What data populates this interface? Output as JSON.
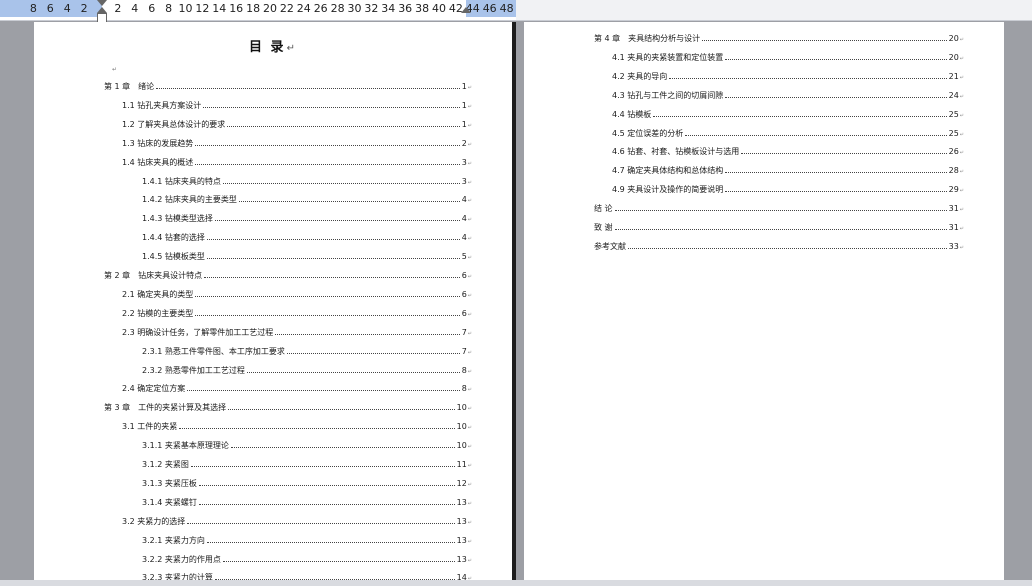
{
  "ruler": {
    "numbers": [
      "8",
      "6",
      "4",
      "2",
      "2",
      "4",
      "6",
      "8",
      "10",
      "12",
      "14",
      "16",
      "18",
      "20",
      "22",
      "24",
      "26",
      "28",
      "30",
      "32",
      "34",
      "36",
      "38",
      "40",
      "42",
      "44",
      "46",
      "48"
    ]
  },
  "toc_title": "目 录",
  "left_page": [
    {
      "level": 1,
      "label": "第 1 章　绪论",
      "page": "1"
    },
    {
      "level": 2,
      "label": "1.1  钻孔夹具方案设计",
      "page": "1"
    },
    {
      "level": 2,
      "label": "1.2  了解夹具总体设计的要求",
      "page": "1"
    },
    {
      "level": 2,
      "label": "1.3  钻床的发展趋势",
      "page": "2"
    },
    {
      "level": 2,
      "label": "1.4 钻床夹具的概述",
      "page": "3"
    },
    {
      "level": 3,
      "label": "1.4.1 钻床夹具的特点",
      "page": "3"
    },
    {
      "level": 3,
      "label": "1.4.2 钻床夹具的主要类型",
      "page": "4"
    },
    {
      "level": 3,
      "label": "1.4.3 钻模类型选择",
      "page": "4"
    },
    {
      "level": 3,
      "label": "1.4.4 钻套的选择",
      "page": "4"
    },
    {
      "level": 3,
      "label": "1.4.5 钻模板类型",
      "page": "5"
    },
    {
      "level": 1,
      "label": "第 2 章　钻床夹具设计特点",
      "page": "6"
    },
    {
      "level": 2,
      "label": "2.1  确定夹具的类型",
      "page": "6"
    },
    {
      "level": 2,
      "label": "2.2  钻模的主要类型",
      "page": "6"
    },
    {
      "level": 2,
      "label": "2.3  明确设计任务，了解零件加工工艺过程",
      "page": "7"
    },
    {
      "level": 3,
      "label": "2.3.1  熟悉工件零件图、本工序加工要求",
      "page": "7"
    },
    {
      "level": 3,
      "label": "2.3.2  熟悉零件加工工艺过程",
      "page": "8"
    },
    {
      "level": 2,
      "label": "2.4 确定定位方案",
      "page": "8"
    },
    {
      "level": 1,
      "label": "第 3 章　工件的夹紧计算及其选择",
      "page": "10"
    },
    {
      "level": 2,
      "label": "3.1  工件的夹紧",
      "page": "10"
    },
    {
      "level": 3,
      "label": "3.1.1  夹紧基本原理理论",
      "page": "10"
    },
    {
      "level": 3,
      "label": "3.1.2  夹紧图",
      "page": "11"
    },
    {
      "level": 3,
      "label": "3.1.3  夹紧压板",
      "page": "12"
    },
    {
      "level": 3,
      "label": "3.1.4  夹紧螺钉",
      "page": "13"
    },
    {
      "level": 2,
      "label": "3.2  夹紧力的选择",
      "page": "13"
    },
    {
      "level": 3,
      "label": "3.2.1  夹紧力方向",
      "page": "13"
    },
    {
      "level": 3,
      "label": "3.2.2  夹紧力的作用点",
      "page": "13"
    },
    {
      "level": 3,
      "label": "3.2.3  夹紧力的计算",
      "page": "14"
    }
  ],
  "right_page": [
    {
      "level": 1,
      "label": "第 4 章　夹具结构分析与设计",
      "page": "20"
    },
    {
      "level": 2,
      "label": "4.1  夹具的夹紧装置和定位装置",
      "page": "20"
    },
    {
      "level": 2,
      "label": "4.2  夹具的导向",
      "page": "21"
    },
    {
      "level": 2,
      "label": "4.3  钻孔与工件之间的切屑间隙",
      "page": "24"
    },
    {
      "level": 2,
      "label": "4.4  钻模板",
      "page": "25"
    },
    {
      "level": 2,
      "label": "4.5 定位误差的分析",
      "page": "25"
    },
    {
      "level": 2,
      "label": "4.6  钻套、衬套、钻模板设计与选用",
      "page": "26"
    },
    {
      "level": 2,
      "label": "4.7  确定夹具体结构和总体结构",
      "page": "28"
    },
    {
      "level": 2,
      "label": "4.9  夹具设计及操作的简要说明",
      "page": "29"
    },
    {
      "level": 1,
      "label": "结  论",
      "page": "31"
    },
    {
      "level": 1,
      "label": "致    谢",
      "page": "31"
    },
    {
      "level": 1,
      "label": "参考文献",
      "page": "33"
    }
  ]
}
